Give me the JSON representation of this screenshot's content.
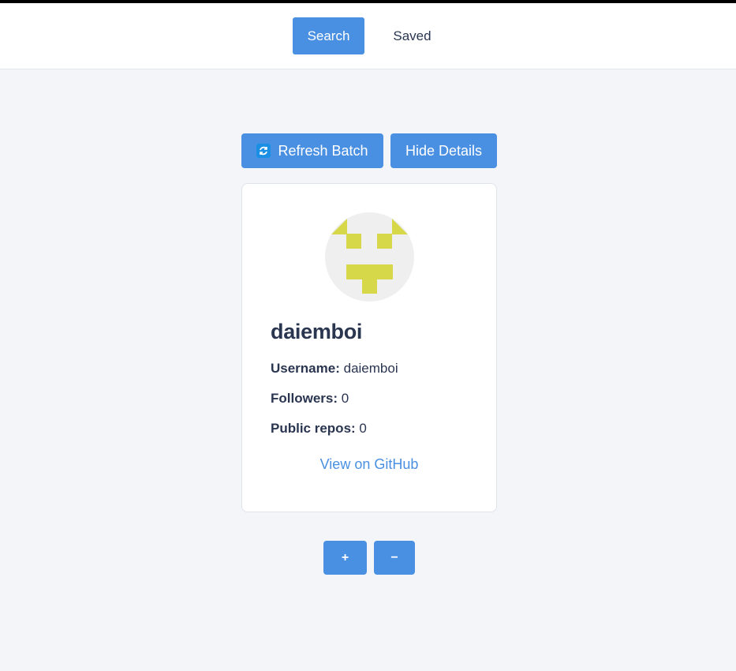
{
  "nav": {
    "search_label": "Search",
    "saved_label": "Saved"
  },
  "actions": {
    "refresh_label": "Refresh Batch",
    "hide_label": "Hide Details",
    "refresh_icon": "refresh-icon"
  },
  "profile": {
    "display_name": "daiemboi",
    "username_label": "Username:",
    "username_value": "daiemboi",
    "followers_label": "Followers:",
    "followers_value": "0",
    "repos_label": "Public repos:",
    "repos_value": "0",
    "link_text": "View on GitHub",
    "avatar_color": "#d6d84a"
  },
  "zoom": {
    "plus_label": "+",
    "minus_label": "−"
  },
  "colors": {
    "accent": "#4a90e2",
    "background": "#f3f5f9",
    "text": "#2a3550"
  }
}
